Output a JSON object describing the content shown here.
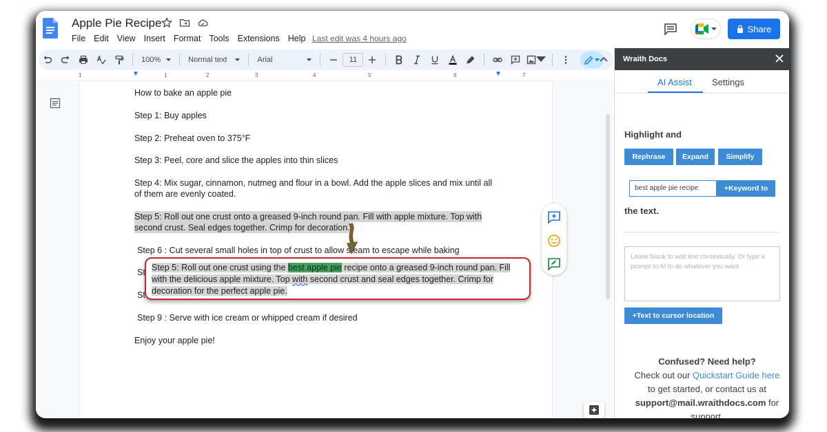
{
  "doc": {
    "title": "Apple Pie Recipe",
    "menu": [
      "File",
      "Edit",
      "View",
      "Insert",
      "Format",
      "Tools",
      "Extensions",
      "Help"
    ],
    "last_edit": "Last edit was 4 hours ago",
    "share_label": "Share"
  },
  "toolbar": {
    "zoom": "100%",
    "style": "Normal text",
    "font": "Arial",
    "font_size": "11"
  },
  "ruler": {
    "ticks": [
      "1",
      "1",
      "2",
      "3",
      "4",
      "5",
      "6",
      "7"
    ]
  },
  "content": {
    "lines": [
      "How to bake an apple pie",
      "Step 1: Buy apples",
      "Step 2: Preheat oven to 375°F",
      "Step 3: Peel, core and slice the apples into thin slices",
      "Step 4: Mix sugar, cinnamon, nutmeg and flour in a bowl. Add the apple slices and mix until all",
      "of them are evenly coated.",
      "Step 5: Roll out one crust onto a greased 9-inch round pan. Fill with apple mixture. Top with",
      "second crust. Seal edges together. Crimp for decoration.",
      "Step 6 : Cut several small holes in top of crust to allow steam to escape while baking",
      "Step 9 : Serve with ice cream or whipped cream if desired",
      "Enjoy your apple pie!"
    ],
    "hidden_prefix_a": "St",
    "hidden_prefix_b": "St"
  },
  "callout": {
    "part1": "Step 5: Roll out one crust using the ",
    "keyword": "best apple pie",
    "part2": " recipe onto a greased 9-inch round pan. Fill",
    "line2a": "with the delicious apple mixture. Top ",
    "line2b": "with",
    "line2c": " second crust and seal edges together. Crimp for",
    "line3": "decoration for the perfect apple pie."
  },
  "panel": {
    "title": "Wraith Docs",
    "tabs": [
      "AI Assist",
      "Settings"
    ],
    "highlight_label": "Highlight and",
    "buttons": [
      "Rephrase",
      "Expand",
      "Simplify"
    ],
    "keyword_value": "best apple pie recipe",
    "keyword_button": "+Keyword to",
    "the_text": "the text.",
    "prompt_placeholder": "Leave blank to add text contextually. Or type a prompt to AI to do whatever you want.",
    "cursor_button": "+Text to cursor location",
    "help_title": "Confused? Need help?",
    "help_line1": "Check out our ",
    "help_link": "Quickstart Guide here",
    "help_line2": "to get started, or contact us at",
    "help_email": "support@mail.wraithdocs.com",
    "help_for": " for",
    "help_end": "support."
  }
}
